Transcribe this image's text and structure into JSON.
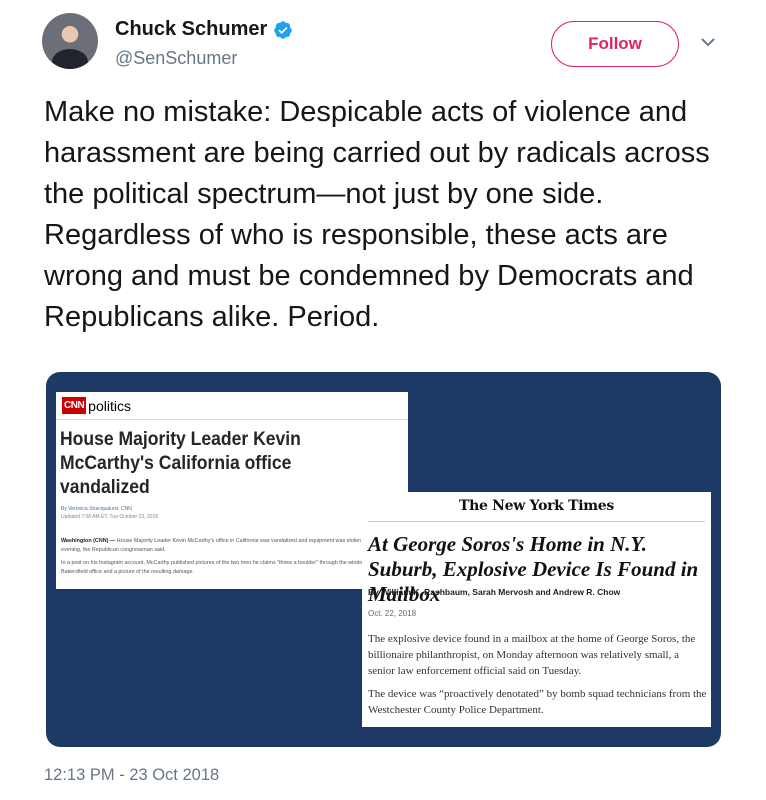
{
  "author": {
    "display_name": "Chuck Schumer",
    "handle": "@SenSchumer",
    "verified": true,
    "avatar_icon": "profile-photo"
  },
  "follow_button": {
    "label": "Follow",
    "color": "#e0245e"
  },
  "menu_icon": "chevron-down-icon",
  "tweet": {
    "text": "Make no mistake: Despicable acts of violence and harassment are being carried out by radicals across the political spectrum—not just by one side. Regardless of who is responsible, these acts are wrong and must be condemned by Democrats and Republicans alike. Period.",
    "timestamp": "12:13 PM - 23 Oct 2018"
  },
  "media": {
    "background_color": "#1f3967",
    "cnn": {
      "logo": "CNN",
      "section": "politics",
      "headline": "House Majority Leader Kevin McCarthy's California office vandalized",
      "byline": "By Veronica Stracqualursi, CNN",
      "updated": "Updated 7:08 AM ET, Tue October 23, 2018",
      "dateline": "Washington (CNN) —",
      "paragraph1": "House Majority Leader Kevin McCarthy's office in California was vandalized and equipment was stolen Monday evening, the Republican congressman said.",
      "paragraph2": "In a post on his Instagram account, McCarthy published pictures of the two men he claims \"threw a boulder\" through the window of his Bakersfield office and a picture of the resulting damage."
    },
    "nyt": {
      "masthead": "The New York Times",
      "headline": "At George Soros's Home in N.Y. Suburb, Explosive Device Is Found in Mailbox",
      "byline": "By William K. Rashbaum, Sarah Mervosh and Andrew R. Chow",
      "date": "Oct. 22, 2018",
      "paragraph1": "The explosive device found in a mailbox at the home of George Soros, the billionaire philanthropist, on Monday afternoon was relatively small, a senior law enforcement official said on Tuesday.",
      "paragraph2": "The device was “proactively denotated” by bomb squad technicians from the Westchester County Police Department."
    }
  }
}
